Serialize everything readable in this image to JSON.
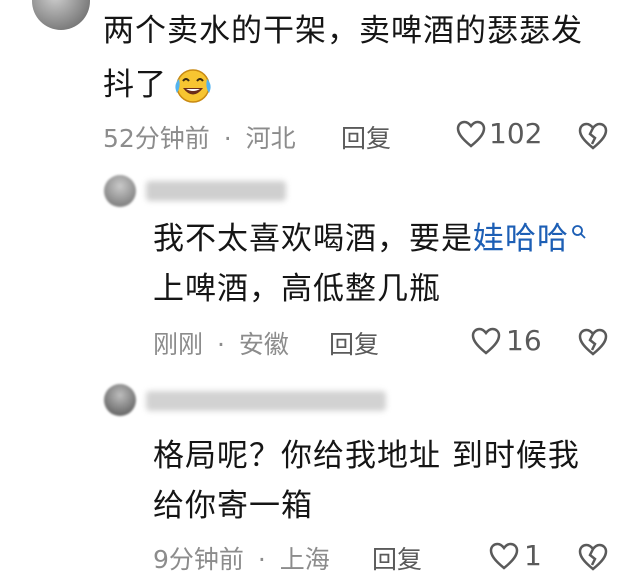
{
  "comments": [
    {
      "text_line1": "两个卖水的干架，卖啤酒的瑟瑟发",
      "text_line2": "抖了",
      "emoji": "laughing-tears-emoji",
      "time": "52分钟前",
      "location": "河北",
      "reply_label": "回复",
      "likes": "102"
    },
    {
      "text_line1_prefix": "我不太喜欢喝酒，要是",
      "mention": "娃哈哈",
      "text_line2": "上啤酒，高低整几瓶",
      "time": "刚刚",
      "location": "安徽",
      "reply_label": "回复",
      "likes": "16"
    },
    {
      "text_line1": "格局呢？你给我地址 到时候我",
      "text_line2": "给你寄一箱",
      "time": "9分钟前",
      "location": "上海",
      "reply_label": "回复",
      "likes": "1"
    }
  ],
  "separator": "·",
  "icons": {
    "like": "heart-outline-icon",
    "dislike": "broken-heart-icon",
    "mention_search": "search-icon"
  },
  "colors": {
    "mention_link": "#1d5fb5",
    "meta_gray": "#8c8c8c"
  }
}
